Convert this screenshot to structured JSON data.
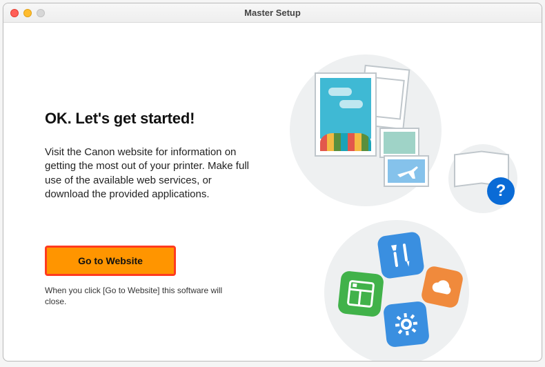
{
  "window": {
    "title": "Master Setup"
  },
  "main": {
    "heading": "OK. Let's get started!",
    "body": "Visit the Canon website for information on getting the most out of your printer. Make full use of the available web services, or download the provided applications.",
    "cta_label": "Go to Website",
    "note": "When you click [Go to Website] this software will close."
  },
  "illustration": {
    "help_badge": "?"
  }
}
